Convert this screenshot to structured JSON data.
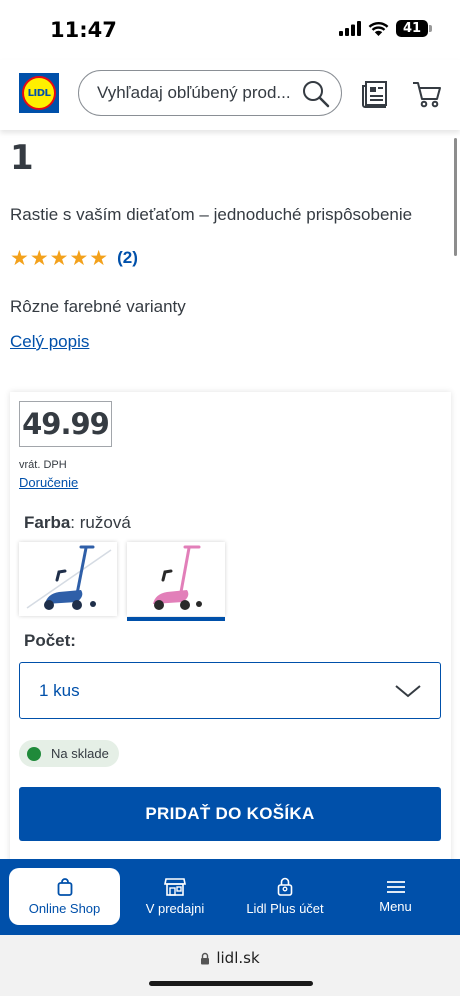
{
  "status_bar": {
    "time": "11:47",
    "battery": "41"
  },
  "header": {
    "logo_text": "LIDL",
    "search_placeholder": "Vyhľadaj obľúbený prod..."
  },
  "product": {
    "partial_title": "1",
    "subtitle": "Rastie s vaším dieťaťom – jednoduché prispôsobenie",
    "rating_stars": "★★★★★",
    "rating_count": "(2)",
    "variants_text": "Rôzne farebné varianty",
    "full_description_link": "Celý popis"
  },
  "buy_box": {
    "price": "49.99",
    "vat_note": "vrát. DPH",
    "delivery_link": "Doručenie",
    "color_label": "Farba",
    "color_value": ": ružová",
    "swatches": [
      {
        "color": "#2f5fa8",
        "selected": false
      },
      {
        "color": "#e27fb9",
        "selected": true
      }
    ],
    "quantity_label": "Počet:",
    "quantity_value": "1 kus",
    "stock_status": "Na sklade",
    "add_to_cart": "PRIDAŤ DO KOŠÍKA"
  },
  "bottom_nav": {
    "items": [
      {
        "label": "Online Shop",
        "icon": "shopping-bag-icon",
        "active": true
      },
      {
        "label": "V predajni",
        "icon": "store-icon",
        "active": false
      },
      {
        "label": "Lidl Plus účet",
        "icon": "user-lock-icon",
        "active": false
      },
      {
        "label": "Menu",
        "icon": "menu-icon",
        "active": false
      }
    ]
  },
  "browser": {
    "url": "lidl.sk"
  },
  "colors": {
    "brand_blue": "#0050aa",
    "lidl_yellow": "#fff000",
    "lidl_red": "#e60a14",
    "star_orange": "#f3a11b",
    "stock_green": "#1f8a3a"
  }
}
